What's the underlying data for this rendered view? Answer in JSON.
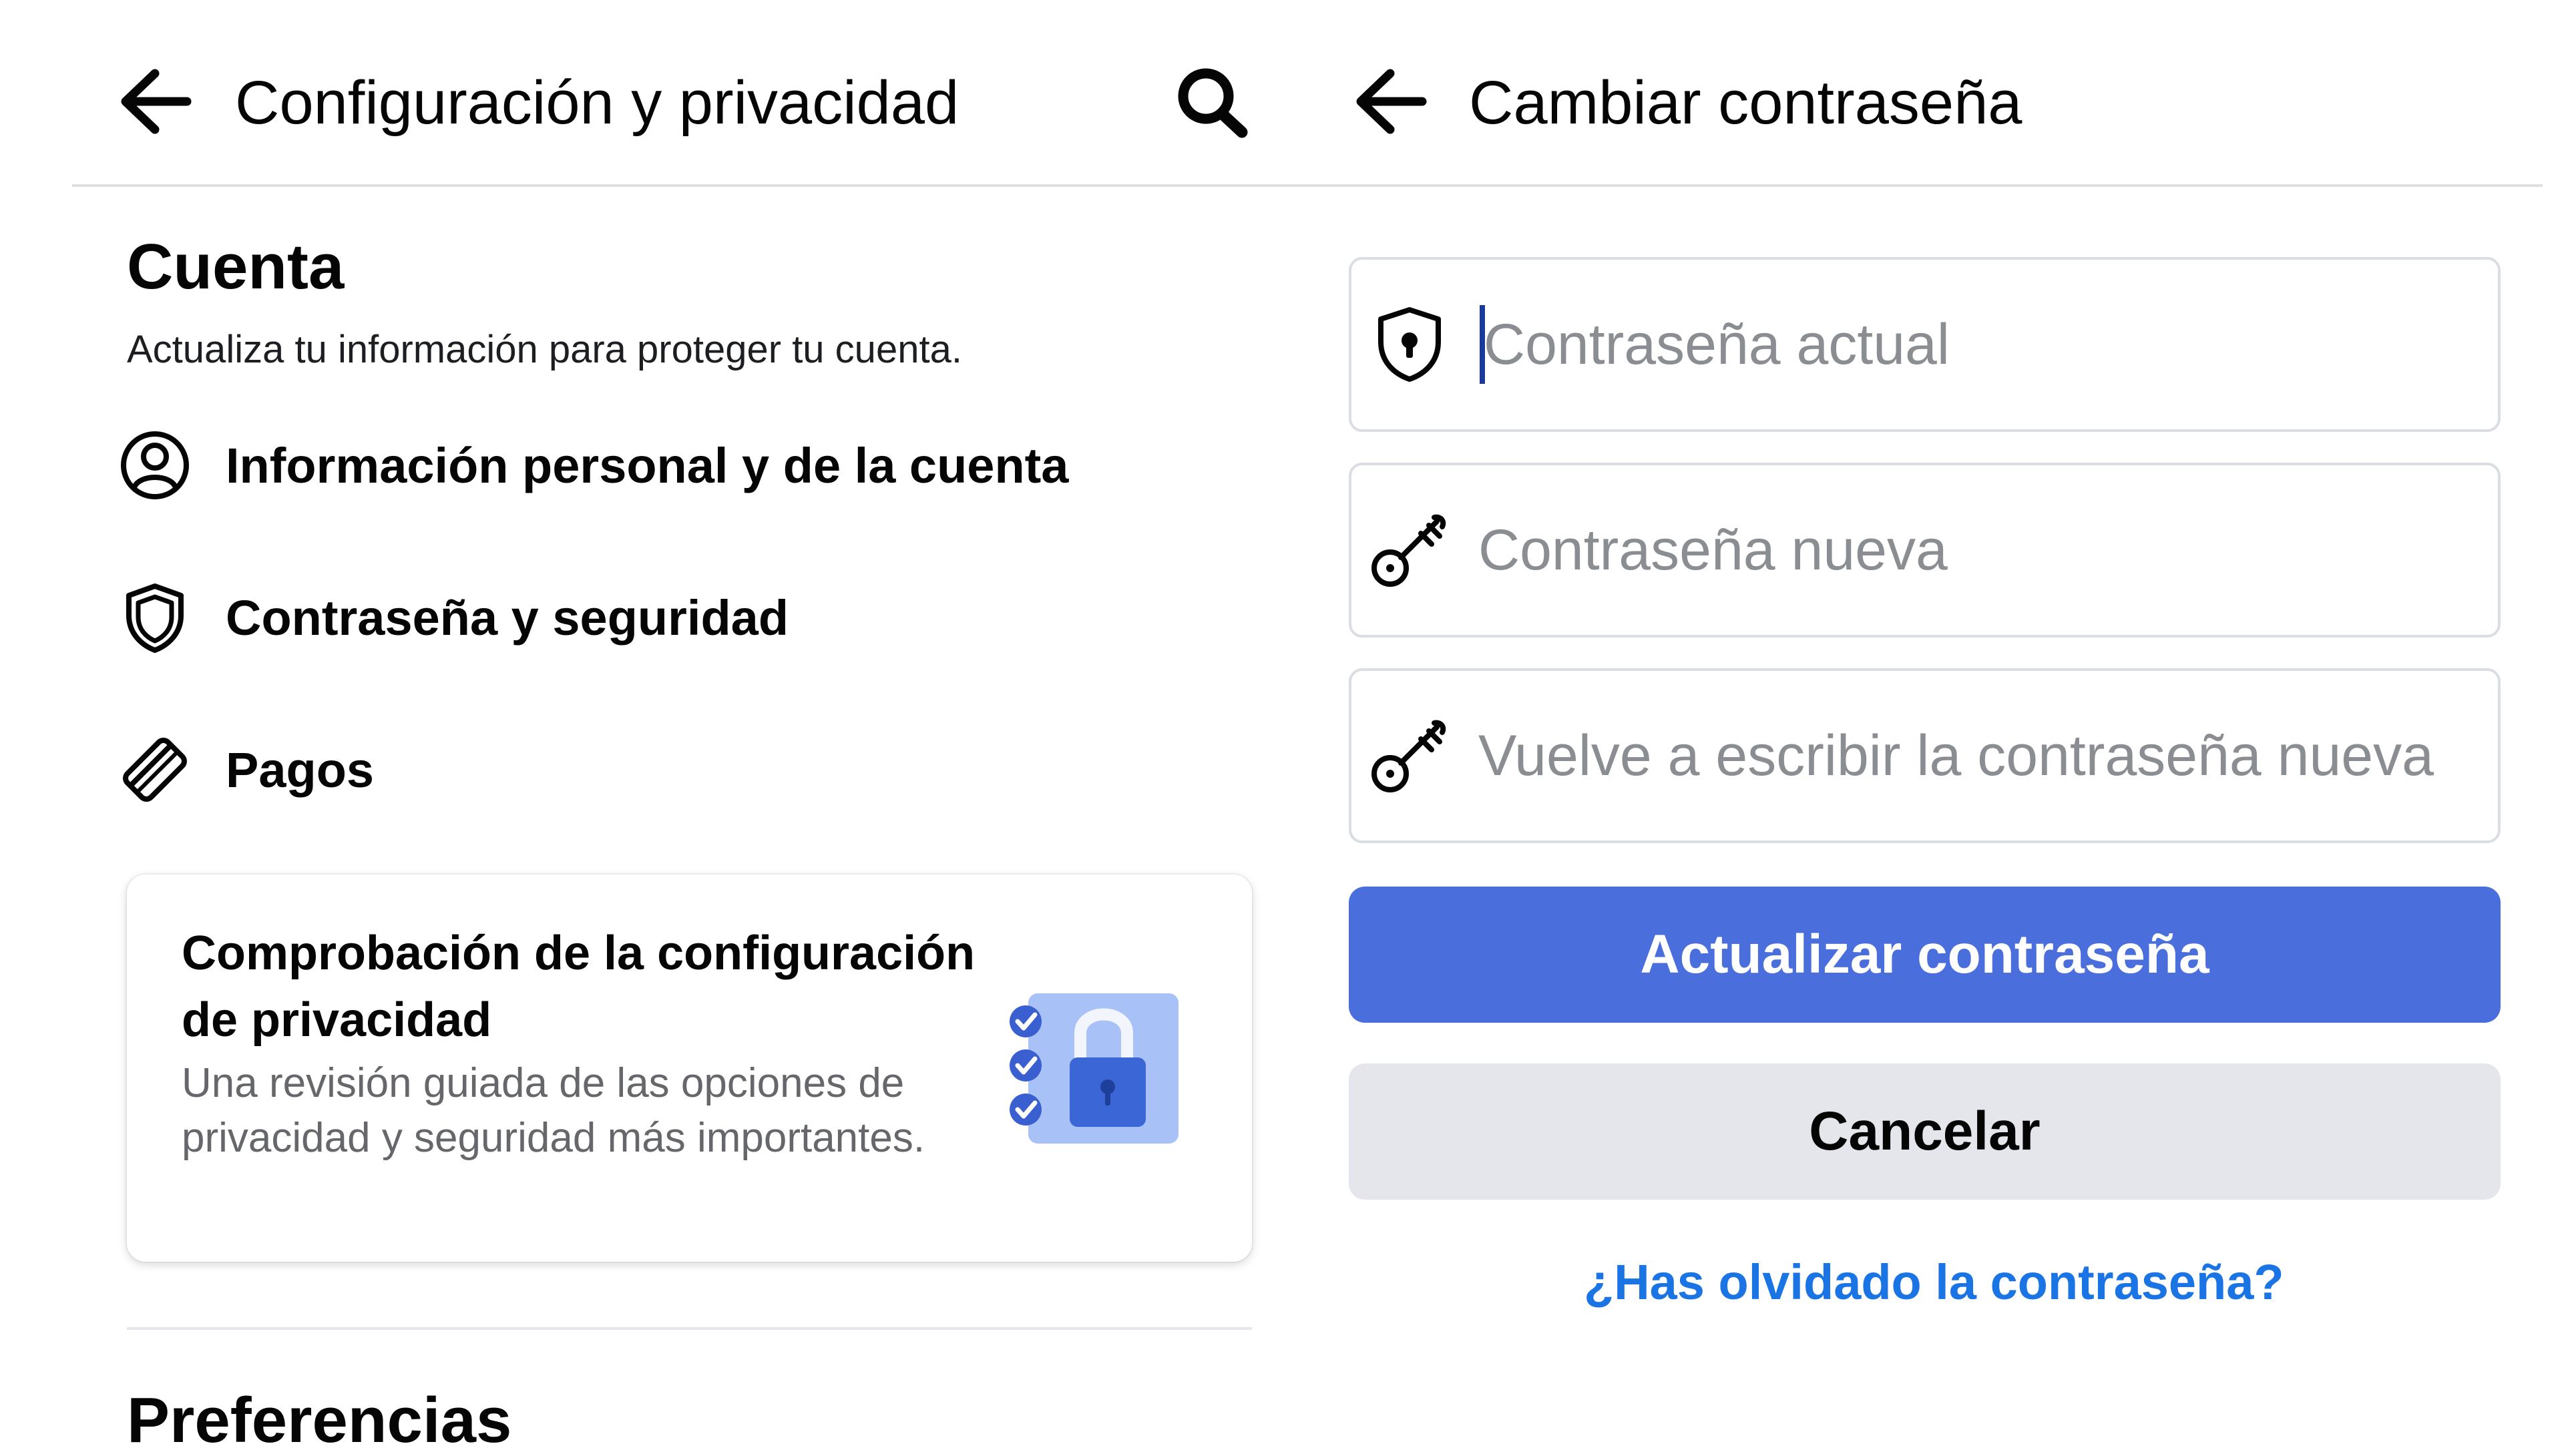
{
  "left_panel": {
    "header": {
      "title": "Configuración y privacidad",
      "back_icon": "arrow-left-icon",
      "search_icon": "search-icon"
    },
    "account_section": {
      "title": "Cuenta",
      "subtitle": "Actualiza tu información para proteger tu cuenta.",
      "items": [
        {
          "label": "Información personal y de la cuenta",
          "icon": "user-circle-icon"
        },
        {
          "label": "Contraseña y seguridad",
          "icon": "shield-icon"
        },
        {
          "label": "Pagos",
          "icon": "tag-icon"
        }
      ]
    },
    "privacy_card": {
      "title": "Comprobación de la configuración de privacidad",
      "description": "Una revisión guiada de las opciones de privacidad y seguridad más importantes.",
      "illustration": "checklist-lock-illustration"
    },
    "preferences_section": {
      "title": "Preferencias"
    }
  },
  "right_panel": {
    "header": {
      "title": "Cambiar contraseña",
      "back_icon": "arrow-left-icon"
    },
    "fields": [
      {
        "placeholder": "Contraseña actual",
        "value": "",
        "icon": "shield-lock-icon",
        "focused": true
      },
      {
        "placeholder": "Contraseña nueva",
        "value": "",
        "icon": "key-icon"
      },
      {
        "placeholder": "Vuelve a escribir la contraseña nueva",
        "value": "",
        "icon": "key-icon"
      }
    ],
    "primary_button": "Actualizar contraseña",
    "cancel_button": "Cancelar",
    "forgot_link": "¿Has olvidado la contraseña?"
  },
  "colors": {
    "primary_button_bg": "#4a6fdc",
    "secondary_button_bg": "#e4e6eb",
    "link": "#1b74e4",
    "placeholder_text": "#8a8d91",
    "caret": "#1a3a9c"
  }
}
